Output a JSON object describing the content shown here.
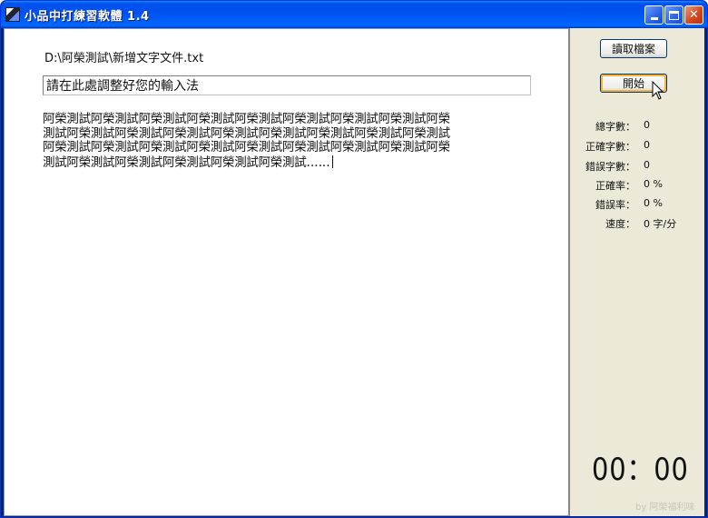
{
  "window": {
    "title": "小品中打練習軟體 1.4",
    "controls": {
      "minimize_icon": "minimize-icon",
      "maximize_icon": "maximize-icon",
      "close_icon": "close-icon",
      "close_glyph": "✕"
    }
  },
  "main": {
    "file_path": "D:\\阿榮測試\\新增文字文件.txt",
    "ime_input_value": "請在此處調整好您的輸入法",
    "practice_text": "阿榮測試阿榮測試阿榮測試阿榮測試阿榮測試阿榮測試阿榮測試阿榮測試阿榮測試阿榮測試阿榮測試阿榮測試阿榮測試阿榮測試阿榮測試阿榮測試阿榮測試阿榮測試阿榮測試阿榮測試阿榮測試阿榮測試阿榮測試阿榮測試阿榮測試阿榮測試阿榮測試阿榮測試阿榮測試阿榮測試阿榮測試‥‥‥"
  },
  "sidebar": {
    "open_file_label": "讀取檔案",
    "start_label": "開始",
    "stats": [
      {
        "label": "總字數：",
        "value": "0"
      },
      {
        "label": "正確字數：",
        "value": "0"
      },
      {
        "label": "錯誤字數：",
        "value": "0"
      },
      {
        "label": "正確率：",
        "value": "0 %"
      },
      {
        "label": "錯誤率：",
        "value": "0 %"
      },
      {
        "label": "速度：",
        "value": "0 字/分"
      }
    ],
    "timer": "00：00",
    "watermark": "by 阿榮福利味"
  },
  "colors": {
    "titlebar_blue": "#0053ee",
    "panel_bg": "#ece9d8",
    "button_focus": "#f8b33c"
  }
}
